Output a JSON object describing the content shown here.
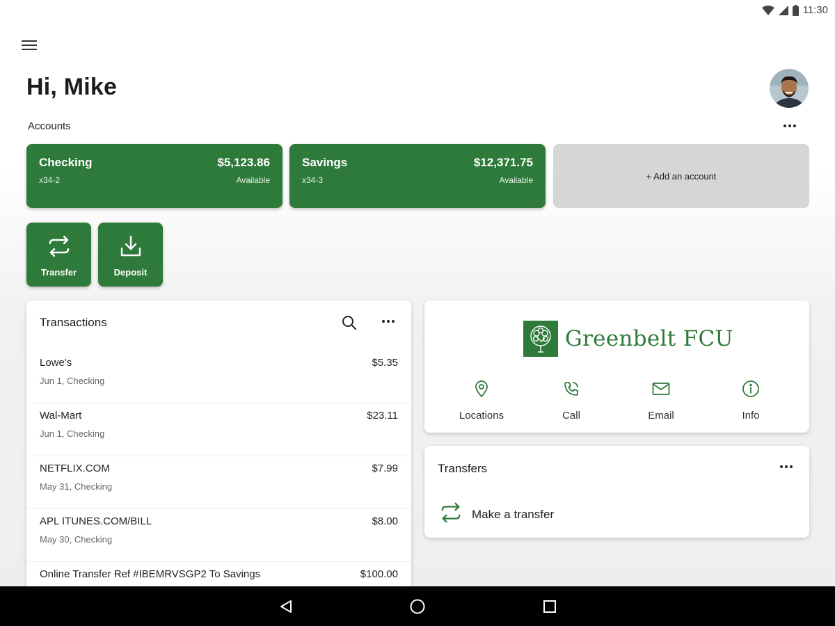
{
  "status_bar": {
    "time": "11:30",
    "icons": [
      "wifi-icon",
      "signal-icon",
      "battery-icon"
    ]
  },
  "header": {
    "greeting": "Hi, Mike",
    "menu_icon": "hamburger-menu-icon",
    "avatar": "user-avatar"
  },
  "accounts": {
    "label": "Accounts",
    "items": [
      {
        "name": "Checking",
        "number": "x34-2",
        "balance": "$5,123.86",
        "balance_label": "Available"
      },
      {
        "name": "Savings",
        "number": "x34-3",
        "balance": "$12,371.75",
        "balance_label": "Available"
      }
    ],
    "add_label": "+ Add an account"
  },
  "actions": [
    {
      "label": "Transfer",
      "icon": "transfer-icon"
    },
    {
      "label": "Deposit",
      "icon": "deposit-icon"
    }
  ],
  "transactions": {
    "title": "Transactions",
    "items": [
      {
        "name": "Lowe's",
        "sub": "Jun 1, Checking",
        "amount": "$5.35"
      },
      {
        "name": "Wal-Mart",
        "sub": "Jun 1, Checking",
        "amount": "$23.11"
      },
      {
        "name": "NETFLIX.COM",
        "sub": "May 31, Checking",
        "amount": "$7.99"
      },
      {
        "name": "APL ITUNES.COM/BILL",
        "sub": "May 30, Checking",
        "amount": "$8.00"
      },
      {
        "name": "Online Transfer Ref #IBEMRVSGP2 To Savings",
        "sub": "",
        "amount": "$100.00"
      }
    ]
  },
  "institution": {
    "name": "Greenbelt FCU",
    "links": [
      {
        "label": "Locations",
        "icon": "location-pin-icon"
      },
      {
        "label": "Call",
        "icon": "phone-icon"
      },
      {
        "label": "Email",
        "icon": "email-icon"
      },
      {
        "label": "Info",
        "icon": "info-icon"
      }
    ]
  },
  "transfers": {
    "title": "Transfers",
    "link_label": "Make a transfer"
  },
  "colors": {
    "brand_green": "#2e7a3a",
    "add_card_gray": "#d6d6d6",
    "nav_bar": "#000000"
  },
  "nav": [
    "back-icon",
    "home-icon",
    "recents-icon"
  ]
}
